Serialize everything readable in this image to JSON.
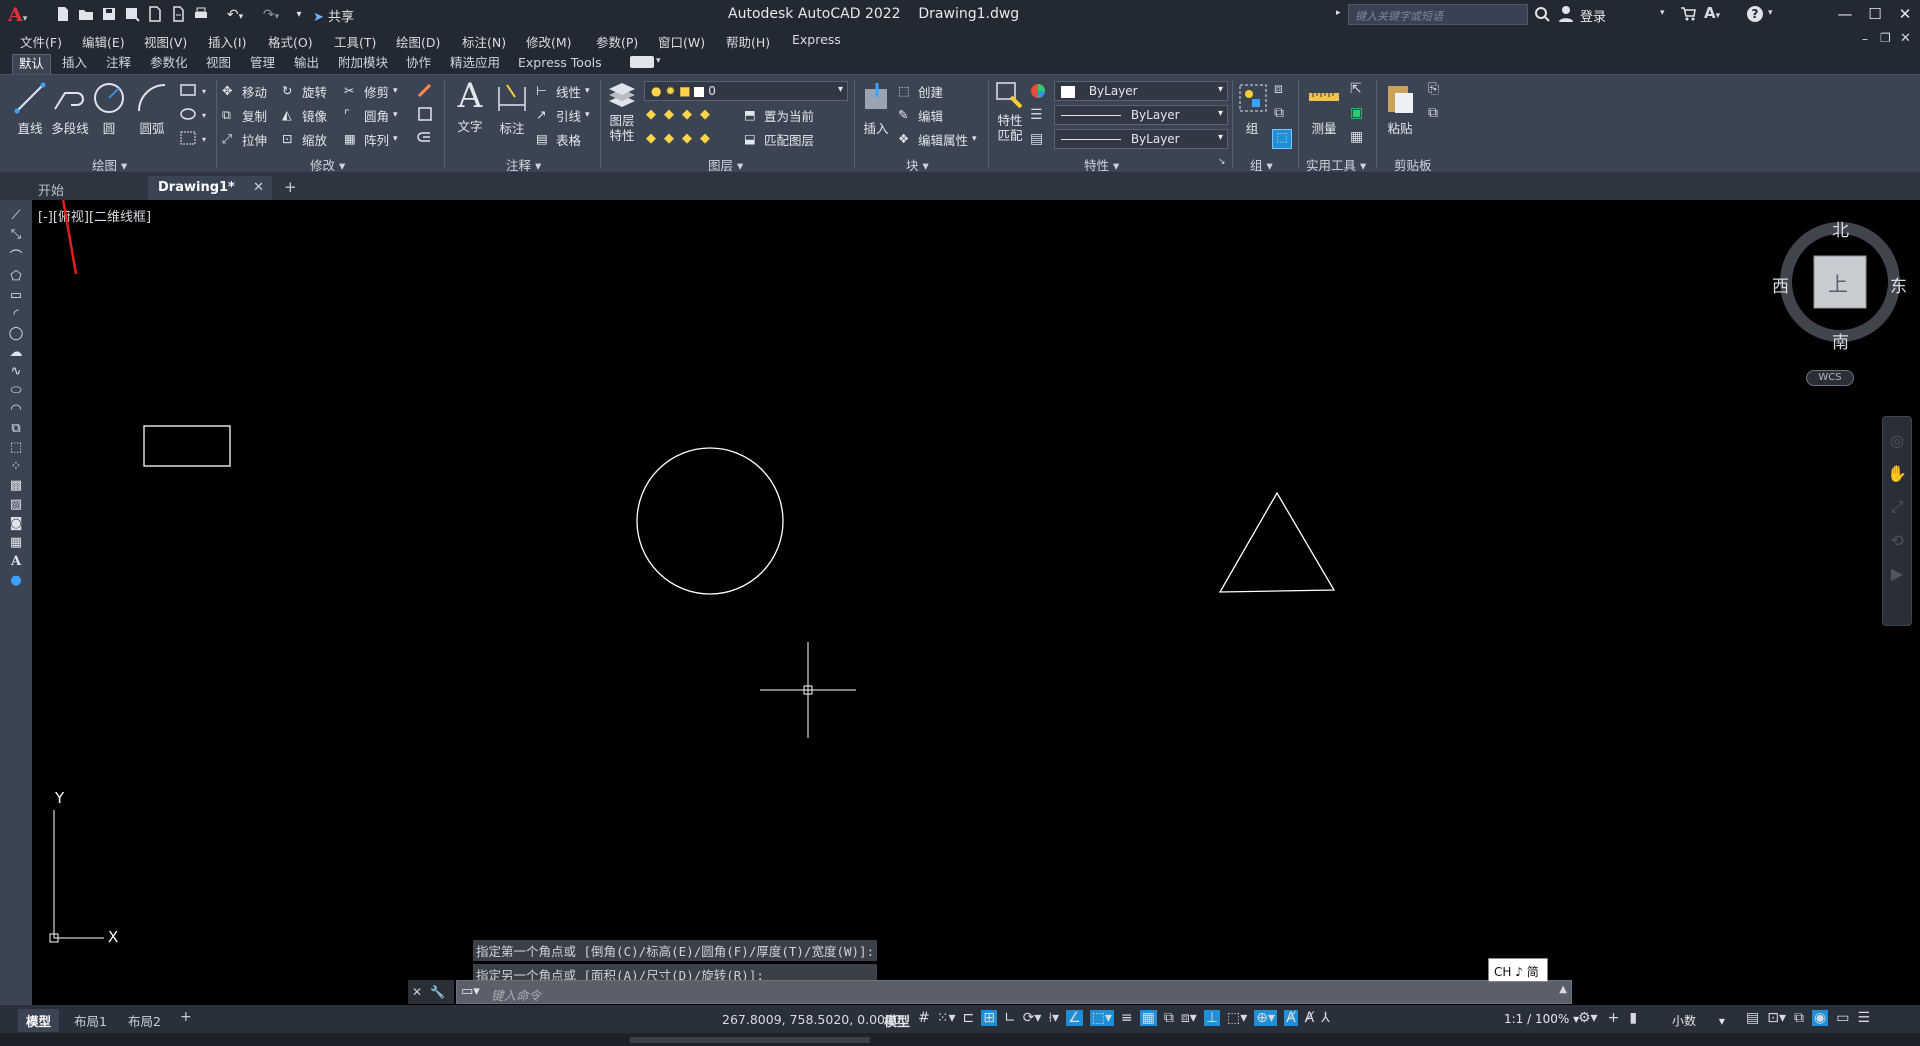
{
  "app": {
    "title": "Autodesk AutoCAD 2022",
    "document": "Drawing1.dwg",
    "share_label": "共享",
    "search_placeholder": "键入关键字或短语",
    "login_label": "登录"
  },
  "menu": [
    "文件(F)",
    "编辑(E)",
    "视图(V)",
    "插入(I)",
    "格式(O)",
    "工具(T)",
    "绘图(D)",
    "标注(N)",
    "修改(M)",
    "参数(P)",
    "窗口(W)",
    "帮助(H)",
    "Express"
  ],
  "ribbon_tabs": [
    "默认",
    "插入",
    "注释",
    "参数化",
    "视图",
    "管理",
    "输出",
    "附加模块",
    "协作",
    "精选应用",
    "Express Tools"
  ],
  "ribbon": {
    "draw": {
      "line": "直线",
      "polyline": "多段线",
      "circle": "圆",
      "arc": "圆弧",
      "panel": "绘图"
    },
    "modify": {
      "move": "移动",
      "rotate": "旋转",
      "trim": "修剪",
      "copy": "复制",
      "mirror": "镜像",
      "fillet": "圆角",
      "stretch": "拉伸",
      "scale": "缩放",
      "array": "阵列",
      "panel": "修改"
    },
    "annotation": {
      "text": "文字",
      "dimension": "标注",
      "linear": "线性",
      "leader": "引线",
      "table": "表格",
      "panel": "注释"
    },
    "layers": {
      "props_line1": "图层",
      "props_line2": "特性",
      "current_layer": "0",
      "set_current": "置为当前",
      "match_layer": "匹配图层",
      "panel": "图层"
    },
    "block": {
      "insert": "插入",
      "create": "创建",
      "edit": "编辑",
      "edit_attr": "编辑属性",
      "panel": "块"
    },
    "properties": {
      "match_line1": "特性",
      "match_line2": "匹配",
      "color": "ByLayer",
      "linetype": "ByLayer",
      "lineweight": "ByLayer",
      "panel": "特性"
    },
    "groups": {
      "group": "组",
      "panel": "组"
    },
    "utilities": {
      "measure": "测量",
      "panel": "实用工具"
    },
    "clipboard": {
      "paste": "粘贴",
      "panel": "剪贴板"
    }
  },
  "doc_tabs": {
    "start": "开始",
    "drawing": "Drawing1*"
  },
  "viewport": {
    "label": "[-][俯视][二维线框]"
  },
  "viewcube": {
    "north": "北",
    "south": "南",
    "east": "东",
    "west": "西",
    "face": "上",
    "wcs": "WCS"
  },
  "ucs": {
    "x": "X",
    "y": "Y"
  },
  "command": {
    "history": [
      "指定第一个角点或 [倒角(C)/标高(E)/圆角(F)/厚度(T)/宽度(W)]:",
      "指定另一个角点或 [面积(A)/尺寸(D)/旋转(R)]:"
    ],
    "placeholder": "键入命令"
  },
  "ime": {
    "label": "CH ♪ 简"
  },
  "status": {
    "tabs": [
      "模型",
      "布局1",
      "布局2"
    ],
    "coordinates": "267.8009, 758.5020, 0.0000",
    "model_label": "模型",
    "scale": "1:1 / 100%",
    "units": "小数"
  },
  "colors": {
    "accent": "#1f8fd6",
    "ribbon_bg": "#3b4453",
    "canvas_bg": "#000000",
    "annotation_arrow": "#e01e1e"
  }
}
